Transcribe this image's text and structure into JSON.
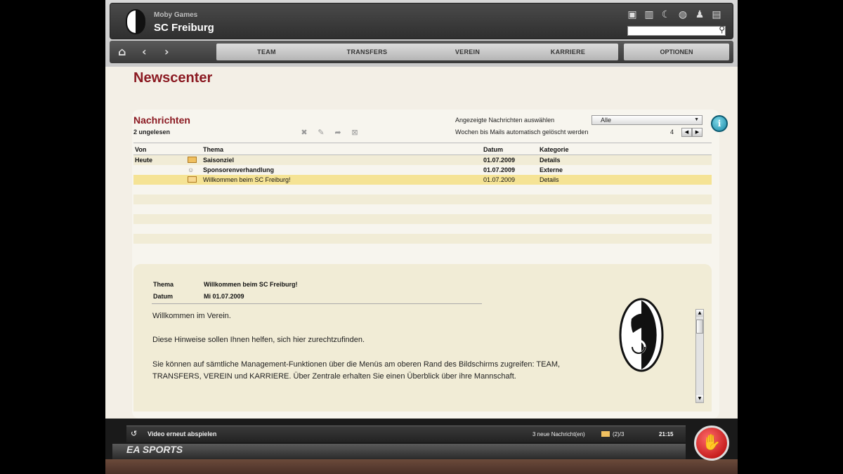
{
  "app": {
    "publisher": "Moby Games",
    "club": "SC Freiburg"
  },
  "search": {
    "placeholder": ""
  },
  "toolbar": {
    "icons": [
      "screen-icon",
      "stats-icon",
      "moon-icon",
      "globe-icon",
      "person-icon",
      "document-icon"
    ]
  },
  "nav": {
    "tabs": [
      "TEAM",
      "TRANSFERS",
      "VEREIN",
      "KARRIERE"
    ],
    "options": "OPTIONEN"
  },
  "page": {
    "title": "Newscenter"
  },
  "messages": {
    "title": "Nachrichten",
    "unread": "2 ungelesen",
    "filter_label": "Angezeigte Nachrichten auswählen",
    "filter_value": "Alle",
    "weeks_label": "Wochen bis Mails automatisch gelöscht werden",
    "weeks_value": "4",
    "columns": [
      "Von",
      "Thema",
      "Datum",
      "Kategorie"
    ],
    "rows": [
      {
        "von": "Heute",
        "thema": "Saisonziel",
        "datum": "01.07.2009",
        "kategorie": "Details",
        "unread": true,
        "icon": "mail-icon"
      },
      {
        "von": "",
        "thema": "Sponsorenverhandlung",
        "datum": "01.07.2009",
        "kategorie": "Externe",
        "unread": true,
        "icon": "people-icon"
      },
      {
        "von": "",
        "thema": "Willkommen beim SC Freiburg!",
        "datum": "01.07.2009",
        "kategorie": "Details",
        "unread": false,
        "icon": "mail-open-icon"
      }
    ]
  },
  "detail": {
    "thema_label": "Thema",
    "thema_value": "Willkommen beim SC Freiburg!",
    "datum_label": "Datum",
    "datum_value": "Mi 01.07.2009",
    "body": [
      "Willkommen im Verein.",
      "Diese Hinweise sollen Ihnen helfen, sich hier zurechtzufinden.",
      "Sie können auf sämtliche Management-Funktionen über die Menüs am oberen Rand des Bildschirms zugreifen: TEAM, TRANSFERS, VEREIN und KARRIERE. Über Zentrale erhalten Sie einen Überblick über ihre Mannschaft."
    ]
  },
  "footer": {
    "replay": "Video erneut abspielen",
    "news_count": "3 neue Nachricht(en)",
    "mail_count": "(2)/3",
    "clock": "21:15",
    "brand": "EA SPORTS"
  },
  "colors": {
    "accent": "#8b1a22",
    "selected_row": "#f5e395",
    "band": "#f1ecd6"
  }
}
